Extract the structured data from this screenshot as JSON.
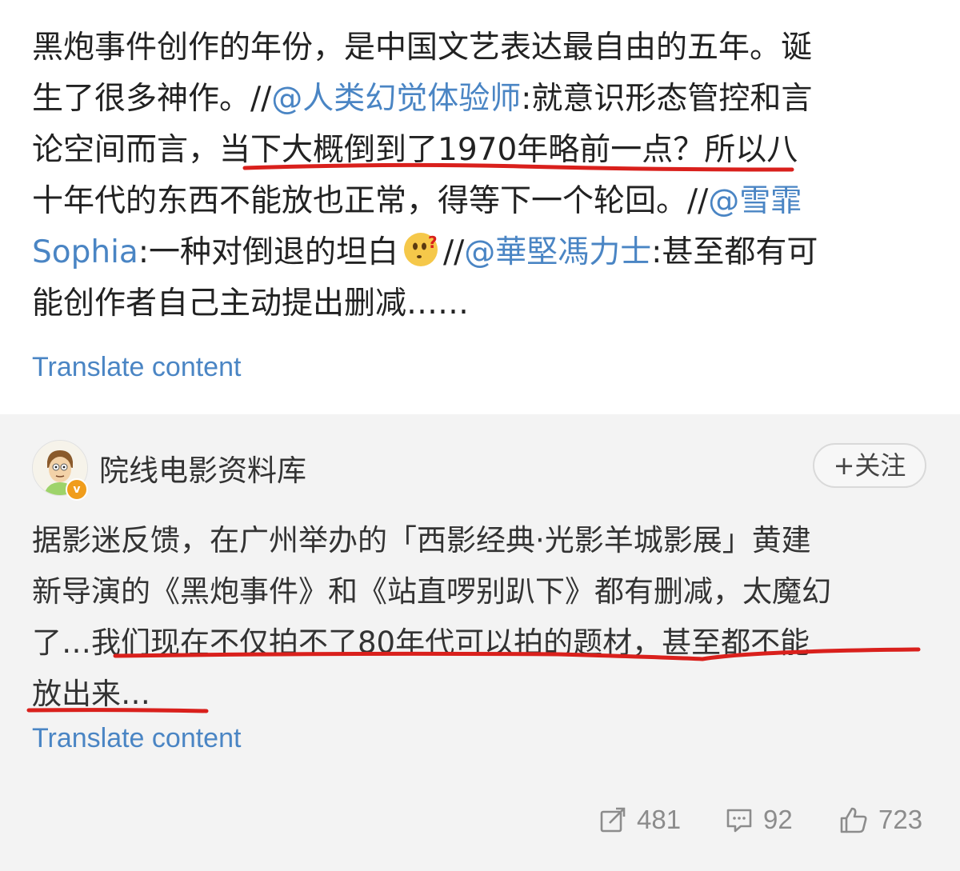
{
  "post": {
    "lines": [
      [
        {
          "t": "黑炮事件创作的年份，是中国文艺表达最自由的五年。诞",
          "m": false
        }
      ],
      [
        {
          "t": "生了很多神作。//",
          "m": false
        },
        {
          "t": "@人类幻觉体验师",
          "m": true
        },
        {
          "t": ":就意识形态管控和言",
          "m": false
        }
      ],
      [
        {
          "t": "论空间而言，当下大概倒到了1970年略前一点？所以八",
          "m": false
        }
      ],
      [
        {
          "t": "十年代的东西不能放也正常，得等下一个轮回。//",
          "m": false
        },
        {
          "t": "@雪霏",
          "m": true
        }
      ],
      [
        {
          "t": "Sophia",
          "m": true
        },
        {
          "t": ":一种对倒退的坦白",
          "m": false
        },
        {
          "t": "EMOJI",
          "m": false
        },
        {
          "t": "//",
          "m": false
        },
        {
          "t": "@華堅馮力士",
          "m": true
        },
        {
          "t": ":甚至都有可",
          "m": false
        }
      ],
      [
        {
          "t": "能创作者自己主动提出删减……",
          "m": false
        }
      ]
    ],
    "translate_label": "Translate content"
  },
  "repost": {
    "author": "院线电影资料库",
    "verified_badge": "v",
    "follow_label": "+关注",
    "lines": [
      "据影迷反馈，在广州举办的「西影经典·光影羊城影展」黄建",
      "新导演的《黑炮事件》和《站直啰别趴下》都有删减，太魔幻",
      "了…我们现在不仅拍不了80年代可以拍的题材，甚至都不能",
      "放出来…"
    ],
    "translate_label": "Translate content",
    "actions": {
      "repost_count": "481",
      "comment_count": "92",
      "like_count": "723"
    }
  },
  "colors": {
    "link": "#4a85c4",
    "underline": "#d9201c",
    "repost_bg": "#f3f3f3",
    "action_gray": "#8c8c8c"
  },
  "icons": {
    "emoji": "thinking-face-emoji",
    "repost": "repost-icon",
    "comment": "comment-icon",
    "like": "thumbs-up-icon"
  }
}
